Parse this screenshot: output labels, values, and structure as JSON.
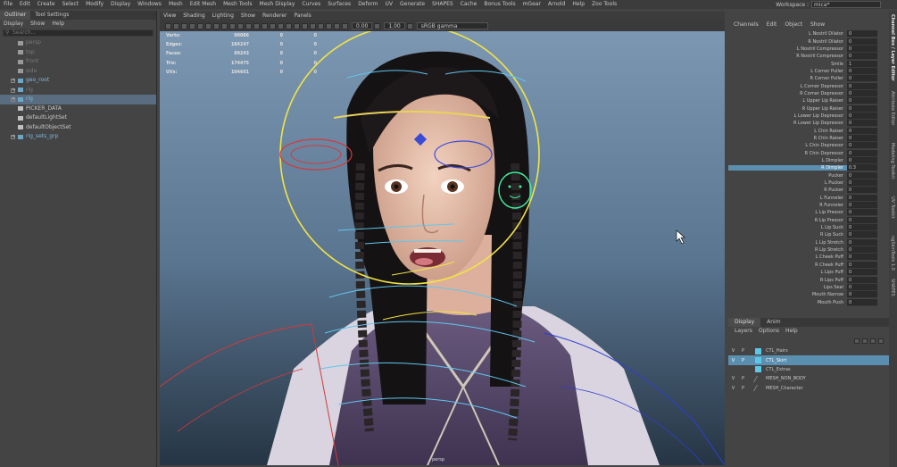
{
  "menubar": {
    "items": [
      "File",
      "Edit",
      "Create",
      "Select",
      "Modify",
      "Display",
      "Windows",
      "Mesh",
      "Edit Mesh",
      "Mesh Tools",
      "Mesh Display",
      "Curves",
      "Surfaces",
      "Deform",
      "UV",
      "Generate",
      "SHAPES",
      "Cache",
      "Bonus Tools",
      "mGear",
      "Arnold",
      "Help",
      "Zoo Tools"
    ],
    "workspace_label": "Workspace :",
    "workspace_value": "mica*"
  },
  "outliner": {
    "tabs": [
      "Outliner",
      "Tool Settings"
    ],
    "menu": [
      "Display",
      "Show",
      "Help"
    ],
    "search_placeholder": "Search...",
    "items": [
      {
        "label": "persp",
        "type": "camera",
        "dim": true,
        "expand": false
      },
      {
        "label": "top",
        "type": "camera",
        "dim": true,
        "expand": false
      },
      {
        "label": "front",
        "type": "camera",
        "dim": true,
        "expand": false
      },
      {
        "label": "side",
        "type": "camera",
        "dim": true,
        "expand": false
      },
      {
        "label": "geo_root",
        "type": "group",
        "dim": false,
        "expand": true
      },
      {
        "label": "rig",
        "type": "group",
        "dim": true,
        "expand": true
      },
      {
        "label": "rig",
        "type": "group",
        "dim": false,
        "expand": true,
        "selected": true
      },
      {
        "label": "PICKER_DATA",
        "type": "node",
        "dim": false,
        "expand": false
      },
      {
        "label": "defaultLightSet",
        "type": "set",
        "dim": false,
        "expand": false
      },
      {
        "label": "defaultObjectSet",
        "type": "set",
        "dim": false,
        "expand": false
      },
      {
        "label": "rig_sets_grp",
        "type": "group",
        "dim": false,
        "expand": true
      }
    ]
  },
  "viewport": {
    "menu": [
      "View",
      "Shading",
      "Lighting",
      "Show",
      "Renderer",
      "Panels"
    ],
    "toolbar": {
      "value1": "0.00",
      "value2": "1.00",
      "colorspace": "sRGB gamma"
    },
    "hud": [
      {
        "label": "Verts:",
        "a": "90086",
        "b": "0",
        "c": "0"
      },
      {
        "label": "Edges:",
        "a": "184247",
        "b": "0",
        "c": "0"
      },
      {
        "label": "Faces:",
        "a": "89243",
        "b": "0",
        "c": "0"
      },
      {
        "label": "Tris:",
        "a": "174475",
        "b": "0",
        "c": "0"
      },
      {
        "label": "UVs:",
        "a": "104601",
        "b": "0",
        "c": "0"
      }
    ],
    "camera_label": "persp"
  },
  "channelbox": {
    "menu": [
      "Channels",
      "Edit",
      "Object",
      "Show"
    ],
    "channels": [
      {
        "name": "L Nostril Dilator",
        "value": "0"
      },
      {
        "name": "R Nostril Dilator",
        "value": "0"
      },
      {
        "name": "L Nostril Compressor",
        "value": "0"
      },
      {
        "name": "R Nostril Compressor",
        "value": "0"
      },
      {
        "name": "Smile",
        "value": "1"
      },
      {
        "name": "L Corner Puller",
        "value": "0"
      },
      {
        "name": "R Corner Puller",
        "value": "0"
      },
      {
        "name": "L Corner Depressor",
        "value": "0"
      },
      {
        "name": "R Corner Depressor",
        "value": "0"
      },
      {
        "name": "L Upper Lip Raiser",
        "value": "0"
      },
      {
        "name": "R Upper Lip Raiser",
        "value": "0"
      },
      {
        "name": "L Lower Lip Depressor",
        "value": "0"
      },
      {
        "name": "R Lower Lip Depressor",
        "value": "0"
      },
      {
        "name": "L Chin Raiser",
        "value": "0"
      },
      {
        "name": "R Chin Raiser",
        "value": "0"
      },
      {
        "name": "L Chin Depressor",
        "value": "0"
      },
      {
        "name": "R Chin Depressor",
        "value": "0"
      },
      {
        "name": "L Dimpler",
        "value": "0"
      },
      {
        "name": "R Dimpler",
        "value": "0.3",
        "selected": true
      },
      {
        "name": "Pucker",
        "value": "0"
      },
      {
        "name": "L Pucker",
        "value": "0"
      },
      {
        "name": "R Pucker",
        "value": "0"
      },
      {
        "name": "L Funneler",
        "value": "0"
      },
      {
        "name": "R Funneler",
        "value": "0"
      },
      {
        "name": "L Lip Pressor",
        "value": "0"
      },
      {
        "name": "R Lip Pressor",
        "value": "0"
      },
      {
        "name": "L Lip Suck",
        "value": "0"
      },
      {
        "name": "R Lip Suck",
        "value": "0"
      },
      {
        "name": "L Lip Stretch",
        "value": "0"
      },
      {
        "name": "R Lip Stretch",
        "value": "0"
      },
      {
        "name": "L Cheek Puff",
        "value": "0"
      },
      {
        "name": "R Cheek Puff",
        "value": "0"
      },
      {
        "name": "L Lips Puff",
        "value": "0"
      },
      {
        "name": "R Lips Puff",
        "value": "0"
      },
      {
        "name": "Lips Seal",
        "value": "0"
      },
      {
        "name": "Mouth Narrow",
        "value": "0"
      },
      {
        "name": "Mouth Push",
        "value": "0"
      }
    ]
  },
  "side_tabs": [
    "Channel Box / Layer Editor",
    "Attribute Editor",
    "Modeling Toolkit",
    "UV Toolkit",
    "ngSkinTools 1.0",
    "SHAPES"
  ],
  "layers": {
    "tabs": [
      "Display",
      "Anim"
    ],
    "menu": [
      "Layers",
      "Options",
      "Help"
    ],
    "rows": [
      {
        "v": "V",
        "p": "P",
        "color": "#5bc8e8",
        "name": "CTL_Hairs",
        "selected": false
      },
      {
        "v": "V",
        "p": "P",
        "color": "#5bc8e8",
        "name": "CTL_Skirt",
        "selected": true
      },
      {
        "v": "",
        "p": "",
        "color": "#5bc8e8",
        "name": "CTL_Extras",
        "selected": false
      },
      {
        "v": "V",
        "p": "P",
        "color": "",
        "name": "MESH_NON_BODY",
        "selected": false
      },
      {
        "v": "V",
        "p": "P",
        "color": "",
        "name": "MESH_Character",
        "selected": false
      }
    ]
  }
}
